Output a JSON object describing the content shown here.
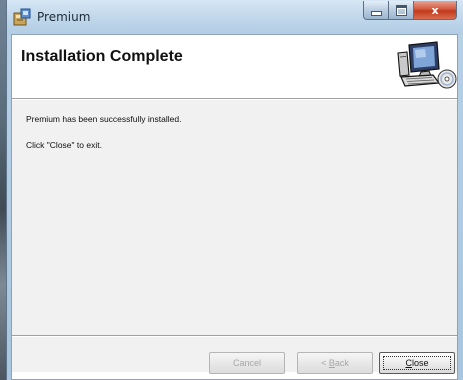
{
  "window": {
    "title": "Premium",
    "icon": "installer-icon",
    "caption_buttons": {
      "minimize": "minimize-icon",
      "maximize": "maximize-icon",
      "close": "x"
    }
  },
  "header": {
    "title": "Installation Complete",
    "graphic": "computer-cd-icon"
  },
  "body": {
    "message_1": "Premium has been successfully installed.",
    "message_2": "Click \"Close\" to exit."
  },
  "buttons": {
    "cancel": "Cancel",
    "back_prefix": "< ",
    "back_mnemonic": "B",
    "back_rest": "ack",
    "close_mnemonic": "C",
    "close_rest": "lose"
  },
  "colors": {
    "close_button": "#c2391b",
    "disabled_text": "#a7a7a7"
  }
}
